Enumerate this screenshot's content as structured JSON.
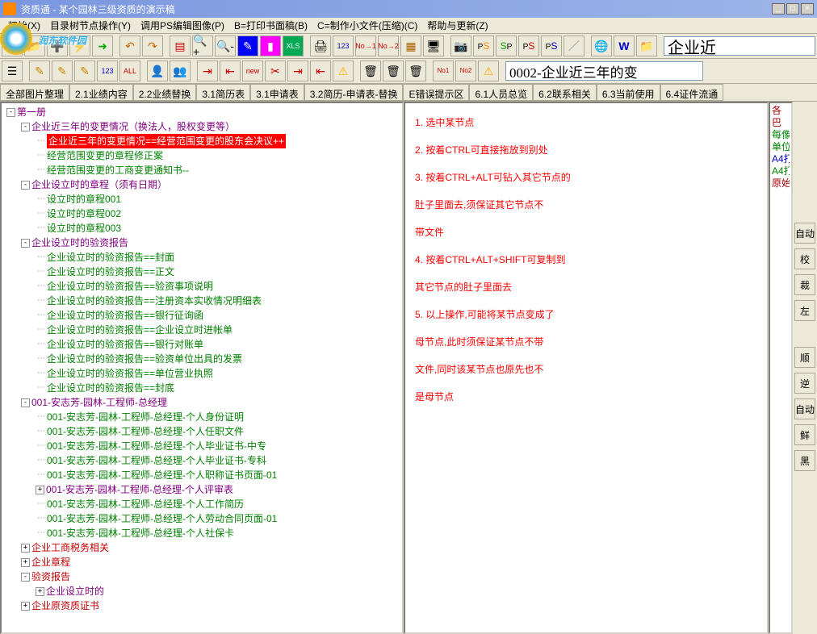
{
  "title": "资质通 - 某个园林三级资质的演示稿",
  "watermark": "润东软件园",
  "menu": [
    "初始(X)",
    "目录树节点操作(Y)",
    "调用PS编辑图像(P)",
    "B=打印书面稿(B)",
    "C=制作小文件(压缩)(C)",
    "帮助与更新(Z)"
  ],
  "toolbar2_text": "0002-企业近三年的变",
  "toolbar1_right": "企业近",
  "tabs": [
    "全部图片整理",
    "2.1业绩内容",
    "2.2业绩替换",
    "3.1简历表",
    "3.1申请表",
    "3.2简历-申请表-替换",
    "E错误提示区",
    "6.1人员总览",
    "6.2联系相关",
    "6.3当前使用",
    "6.4证件流通"
  ],
  "tree": {
    "root": "第一册",
    "n1": "企业近三年的变更情况（换法人，股权变更等）",
    "n1_1": "企业近三年的变更情况==经营范围变更的股东会决议++",
    "n1_2": "经营范围变更的章程修正案",
    "n1_3": "经营范围变更的工商变更通知书--",
    "n2": "企业设立时的章程（须有日期）",
    "n2_1": "设立时的章程001",
    "n2_2": "设立时的章程002",
    "n2_3": "设立时的章程003",
    "n3": "企业设立时的验资报告",
    "n3_1": "企业设立时的验资报告==封面",
    "n3_2": "企业设立时的验资报告==正文",
    "n3_3": "企业设立时的验资报告==验资事项说明",
    "n3_4": "企业设立时的验资报告==注册资本实收情况明细表",
    "n3_5": "企业设立时的验资报告==银行征询函",
    "n3_6": "企业设立时的验资报告==企业设立时进帐单",
    "n3_7": "企业设立时的验资报告==银行对账单",
    "n3_8": "企业设立时的验资报告==验资单位出具的发票",
    "n3_9": "企业设立时的验资报告==单位营业执照",
    "n3_10": "企业设立时的验资报告==封底",
    "n4": "001-安志芳-园林-工程师-总经理",
    "n4_1": "001-安志芳-园林-工程师-总经理-个人身份证明",
    "n4_2": "001-安志芳-园林-工程师-总经理-个人任职文件",
    "n4_3": "001-安志芳-园林-工程师-总经理-个人毕业证书-中专",
    "n4_4": "001-安志芳-园林-工程师-总经理-个人毕业证书-专科",
    "n4_5": "001-安志芳-园林-工程师-总经理-个人职称证书页面-01",
    "n4_6": "001-安志芳-园林-工程师-总经理-个人评审表",
    "n4_7": "001-安志芳-园林-工程师-总经理-个人工作简历",
    "n4_8": "001-安志芳-园林-工程师-总经理-个人劳动合同页面-01",
    "n4_9": "001-安志芳-园林-工程师-总经理-个人社保卡",
    "n5": "企业工商税务相关",
    "n6": "企业章程",
    "n7": "验资报告",
    "n7_1": "企业设立时的",
    "n8": "企业原资质证书"
  },
  "instructions": {
    "l1": "1. 选中某节点",
    "l2": "2. 按着CTRL可直接拖放到别处",
    "l3": "3. 按着CTRL+ALT可钻入其它节点的",
    "l3b": "   肚子里面去,须保证其它节点不",
    "l3c": "   带文件",
    "l4": "4. 按着CTRL+ALT+SHIFT可复制到",
    "l4b": "   其它节点的肚子里面去",
    "l5": "5. 以上操作,可能将某节点变成了",
    "l5b": "   母节点,此时须保证某节点不带",
    "l5c": "   文件,同时该某节点也原先也不",
    "l5d": "   是母节点"
  },
  "rp": {
    "r1": "各",
    "r2": "巴",
    "r3": "每像",
    "r4": "单位",
    "r5": "A4打",
    "r6": "A4打",
    "r7": "原始"
  },
  "rbtns": [
    "自动",
    "校",
    "裁",
    "左",
    "顺",
    "逆",
    "自动",
    "鲜",
    "黑"
  ]
}
